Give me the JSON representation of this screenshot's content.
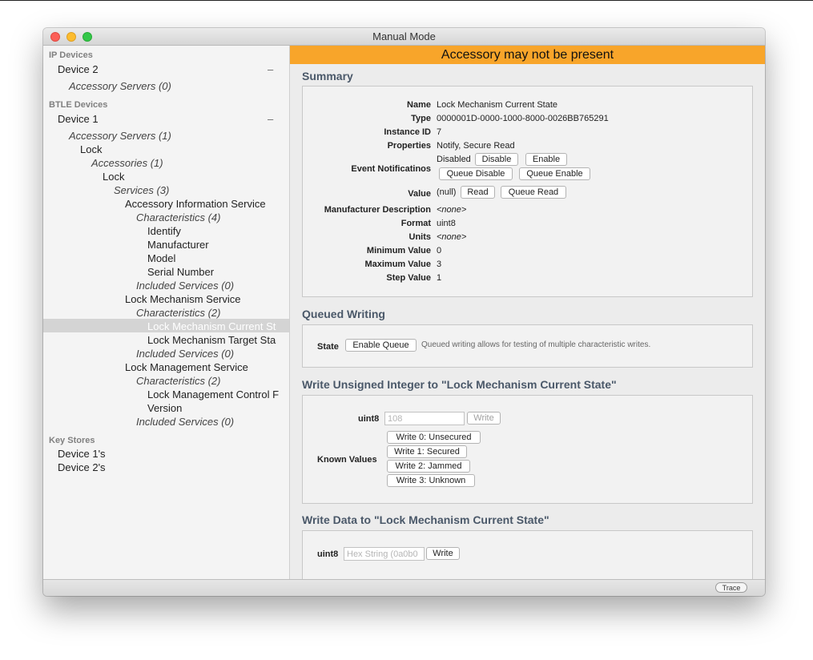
{
  "window": {
    "title": "Manual Mode"
  },
  "sidebar": {
    "sections": [
      {
        "label": "IP Devices"
      },
      {
        "label": "BTLE Devices"
      },
      {
        "label": "Key Stores"
      }
    ],
    "collapse_glyph": "–",
    "items": [
      {
        "label": "Device 2"
      },
      {
        "label": "Accessory Servers (0)"
      },
      {
        "label": "Device 1"
      },
      {
        "label": "Accessory Servers (1)"
      },
      {
        "label": "Lock"
      },
      {
        "label": "Accessories (1)"
      },
      {
        "label": "Lock"
      },
      {
        "label": "Services (3)"
      },
      {
        "label": "Accessory Information Service"
      },
      {
        "label": "Characteristics (4)"
      },
      {
        "label": "Identify"
      },
      {
        "label": "Manufacturer"
      },
      {
        "label": "Model"
      },
      {
        "label": "Serial Number"
      },
      {
        "label": "Included Services (0)"
      },
      {
        "label": "Lock Mechanism Service"
      },
      {
        "label": "Characteristics (2)"
      },
      {
        "label": "Lock Mechanism Current St"
      },
      {
        "label": "Lock Mechanism Target Sta"
      },
      {
        "label": "Included Services (0)"
      },
      {
        "label": "Lock Management Service"
      },
      {
        "label": "Characteristics (2)"
      },
      {
        "label": "Lock Management Control F"
      },
      {
        "label": "Version"
      },
      {
        "label": "Included Services (0)"
      },
      {
        "label": "Device 1's"
      },
      {
        "label": "Device 2's"
      }
    ],
    "add_glyph": "+"
  },
  "banner": {
    "text": "Accessory may not be present",
    "color": "#f8a52a"
  },
  "summary": {
    "title": "Summary",
    "rows": [
      {
        "label": "Name",
        "value": "Lock Mechanism Current State"
      },
      {
        "label": "Type",
        "value": "0000001D-0000-1000-8000-0026BB765291"
      },
      {
        "label": "Instance ID",
        "value": "7"
      },
      {
        "label": "Properties",
        "value": "Notify, Secure Read"
      }
    ],
    "event": {
      "label": "Event Notificatinos",
      "status": "Disabled",
      "disable": "Disable",
      "enable": "Enable",
      "queue_disable": "Queue Disable",
      "queue_enable": "Queue Enable"
    },
    "value": {
      "label": "Value",
      "value": "(null)",
      "read": "Read",
      "queue_read": "Queue Read"
    },
    "rows2": [
      {
        "label": "Manufacturer Description",
        "value": "<none>"
      },
      {
        "label": "Format",
        "value": "uint8"
      },
      {
        "label": "Units",
        "value": "<none>"
      },
      {
        "label": "Minimum Value",
        "value": "0"
      },
      {
        "label": "Maximum Value",
        "value": "3"
      },
      {
        "label": "Step Value",
        "value": "1"
      }
    ]
  },
  "queued": {
    "title": "Queued Writing",
    "state_label": "State",
    "button": "Enable Queue",
    "note": "Queued writing allows for testing of multiple characteristic writes."
  },
  "write_uint": {
    "title": "Write Unsigned Integer to \"Lock Mechanism Current State\"",
    "field_label": "uint8",
    "placeholder": "108",
    "write": "Write",
    "known_label": "Known Values",
    "known": [
      {
        "label": "Write 0: Unsecured"
      },
      {
        "label": "Write 1: Secured"
      },
      {
        "label": "Write 2: Jammed"
      },
      {
        "label": "Write 3: Unknown"
      }
    ]
  },
  "write_data": {
    "title": "Write Data to \"Lock Mechanism Current State\"",
    "field_label": "uint8",
    "placeholder": "Hex String (0a0b0",
    "write": "Write"
  },
  "footer": {
    "trace": "Trace"
  }
}
